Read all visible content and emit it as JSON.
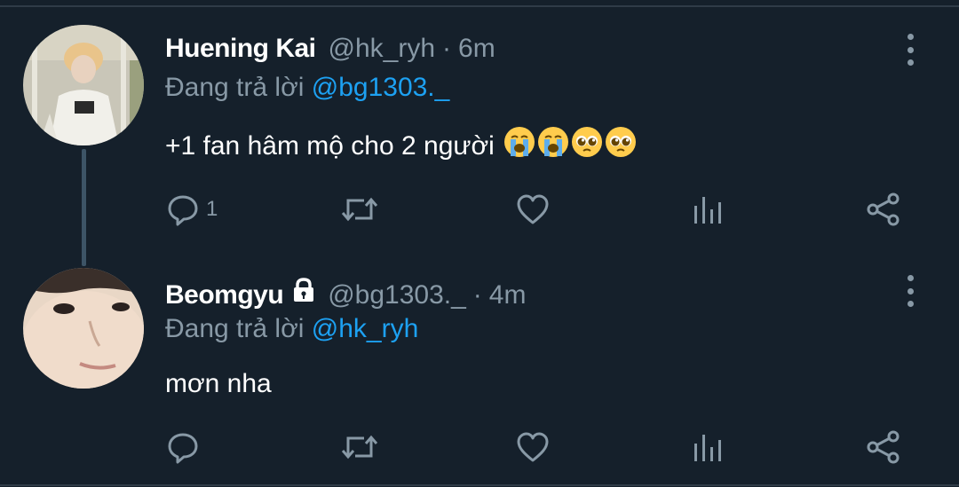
{
  "tweets": [
    {
      "author": "Huening Kai",
      "handle": "@hk_ryh",
      "separator": "·",
      "time": "6m",
      "reply_prefix": "Đang trả lời",
      "reply_to": "@bg1303._",
      "text": "+1 fan hâm mộ cho 2 người",
      "emojis": [
        "loudly-crying-face",
        "loudly-crying-face",
        "pleading-face",
        "pleading-face"
      ],
      "reply_count": "1",
      "protected": false
    },
    {
      "author": "Beomgyu",
      "handle": "@bg1303._",
      "separator": "·",
      "time": "4m",
      "reply_prefix": "Đang trả lời",
      "reply_to": "@hk_ryh",
      "text": "mơn nha",
      "reply_count": "",
      "protected": true
    }
  ],
  "colors": {
    "background": "#15202b",
    "secondary_text": "#8899a6",
    "mention": "#1da1f2",
    "thread_line": "#3d5466"
  }
}
